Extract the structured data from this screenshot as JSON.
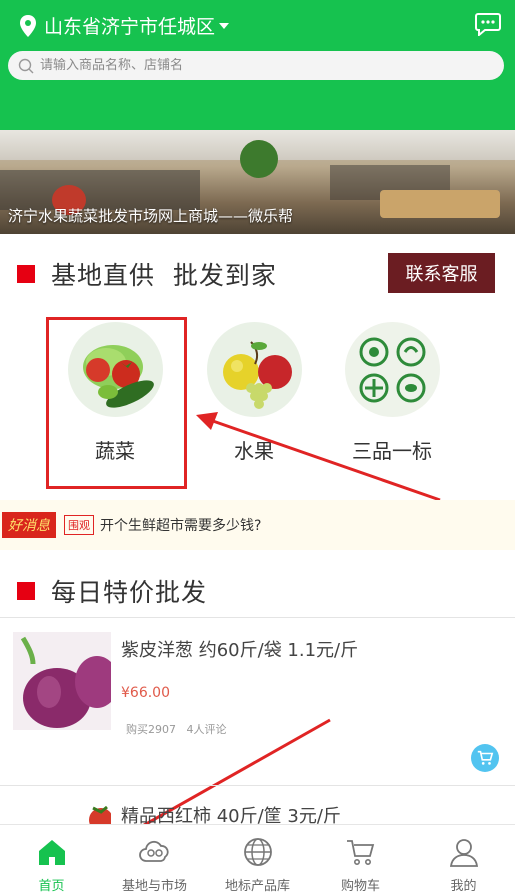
{
  "header": {
    "location": "山东省济宁市任城区",
    "search_placeholder": "请输入商品名称、店铺名"
  },
  "banner": {
    "caption": "济宁水果蔬菜批发市场网上商城——微乐帮"
  },
  "section1": {
    "title": "基地直供  批发到家",
    "contact_button": "联系客服"
  },
  "categories": [
    {
      "label": "蔬菜",
      "icon": "vegetables-icon"
    },
    {
      "label": "水果",
      "icon": "fruits-icon"
    },
    {
      "label": "三品一标",
      "icon": "certification-icon"
    }
  ],
  "ticker": {
    "badge": "好消息",
    "tag": "围观",
    "text": "开个生鲜超市需要多少钱?"
  },
  "section2": {
    "title": "每日特价批发"
  },
  "products": [
    {
      "title": "紫皮洋葱 约60斤/袋  1.1元/斤",
      "price": "¥66.00",
      "bought": "购买2907",
      "reviews": "4人评论"
    },
    {
      "title": "精品西红柿  40斤/筐  3元/斤"
    }
  ],
  "tabs": [
    {
      "label": "首页",
      "icon": "home-icon",
      "active": true
    },
    {
      "label": "基地与市场",
      "icon": "cloud-icon"
    },
    {
      "label": "地标产品库",
      "icon": "globe-icon"
    },
    {
      "label": "购物车",
      "icon": "cart-icon"
    },
    {
      "label": "我的",
      "icon": "user-icon"
    }
  ],
  "colors": {
    "primary_green": "#16c24f",
    "accent_red": "#e60012",
    "contact_button_bg": "#6b1d22",
    "price_red": "#e05a4a",
    "annotation_red": "#e02424"
  }
}
